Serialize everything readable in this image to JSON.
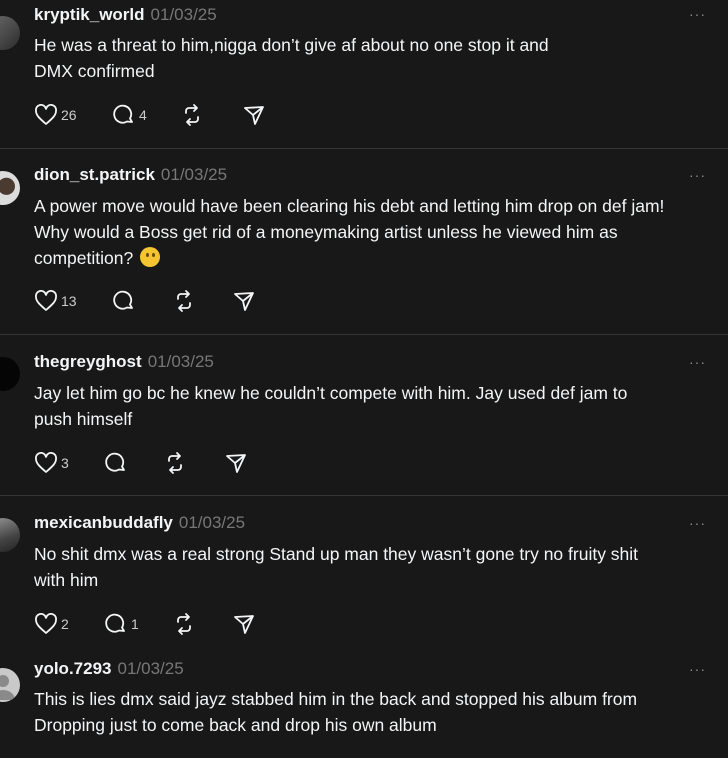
{
  "posts": [
    {
      "username": "kryptik_world",
      "date": "01/03/25",
      "text_lines": [
        "He was a threat to him,nigga don’t give af about no one stop it and",
        "DMX confirmed"
      ],
      "likes": "26",
      "replies": "4",
      "avatar": "photo"
    },
    {
      "username": "dion_st.patrick",
      "date": "01/03/25",
      "text_lines": [
        "A power move would have been clearing his debt and letting him drop on def jam!",
        "Why would a Boss get rid of a moneymaking artist unless he viewed him as",
        "competition?"
      ],
      "emoji": "thinking-face-emoji",
      "likes": "13",
      "replies": "",
      "avatar": "photo"
    },
    {
      "username": "thegreyghost",
      "date": "01/03/25",
      "text_lines": [
        "Jay let him go bc he knew he couldn’t compete with him. Jay used def jam to",
        "push himself"
      ],
      "likes": "3",
      "replies": "",
      "avatar": "black"
    },
    {
      "username": "mexicanbuddafly",
      "date": "01/03/25",
      "text_lines": [
        "No shit dmx was a real strong Stand up man they wasn’t gone try no fruity shit",
        "with him"
      ],
      "likes": "2",
      "replies": "1",
      "avatar": "photo"
    },
    {
      "username": "yolo.7293",
      "date": "01/03/25",
      "text_lines": [
        "This is lies dmx said jayz stabbed him in the back and stopped his album from",
        "Dropping just to come back and drop his own album"
      ],
      "likes": "",
      "replies": "",
      "avatar": "default"
    }
  ],
  "more_label": "···",
  "icons": [
    "heart-icon",
    "reply-icon",
    "repost-icon",
    "share-icon",
    "more-icon"
  ],
  "colors": {
    "background": "#181818",
    "text": "#f3f5f7",
    "muted": "#777777",
    "divider": "#333638"
  }
}
